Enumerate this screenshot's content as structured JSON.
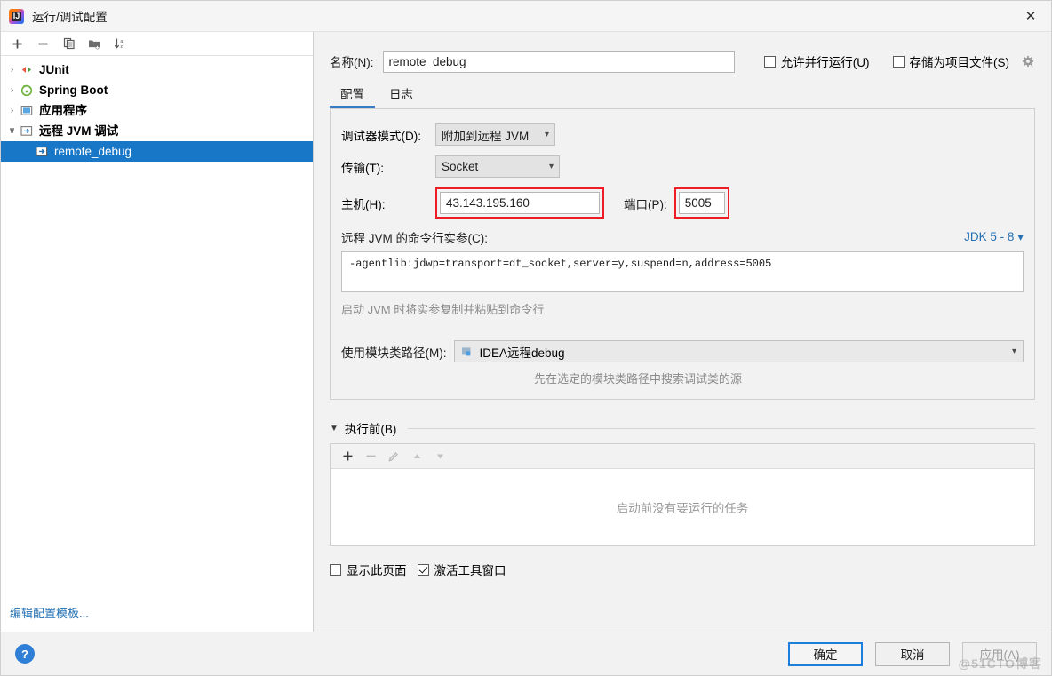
{
  "window": {
    "title": "运行/调试配置",
    "app_icon": "intellij-idea-icon",
    "close_label": "✕"
  },
  "sidebar": {
    "toolbar": [
      {
        "name": "add-configuration-button",
        "glyph": "+"
      },
      {
        "name": "remove-configuration-button",
        "glyph": "–"
      },
      {
        "name": "copy-configuration-button",
        "glyph": "copy-icon"
      },
      {
        "name": "new-folder-button",
        "glyph": "folder-add-icon"
      },
      {
        "name": "sort-configurations-button",
        "glyph": "sort-az-icon"
      }
    ],
    "tree": [
      {
        "label": "JUnit",
        "icon": "junit-icon",
        "expanded": false,
        "selected": false,
        "child": false
      },
      {
        "label": "Spring Boot",
        "icon": "spring-boot-icon",
        "expanded": false,
        "selected": false,
        "child": false
      },
      {
        "label": "应用程序",
        "icon": "application-icon",
        "expanded": false,
        "selected": false,
        "child": false
      },
      {
        "label": "远程 JVM 调试",
        "icon": "remote-jvm-debug-icon",
        "expanded": true,
        "selected": false,
        "child": false
      },
      {
        "label": "remote_debug",
        "icon": "remote-jvm-debug-icon",
        "expanded": null,
        "selected": true,
        "child": true
      }
    ],
    "edit_templates_link": "编辑配置模板..."
  },
  "form": {
    "name_label": "名称(N):",
    "name_value": "remote_debug",
    "allow_parallel_label": "允许并行运行(U)",
    "allow_parallel_checked": false,
    "store_as_project_file_label": "存储为项目文件(S)",
    "store_as_project_file_checked": false,
    "gear_icon": "gear-icon"
  },
  "tabs": [
    {
      "label": "配置",
      "active": true
    },
    {
      "label": "日志",
      "active": false
    }
  ],
  "config": {
    "debugger_mode_label": "调试器模式(D):",
    "debugger_mode_value": "附加到远程 JVM",
    "transport_label": "传输(T):",
    "transport_value": "Socket",
    "host_label": "主机(H):",
    "host_value": "43.143.195.160",
    "port_label": "端口(P):",
    "port_value": "5005",
    "args_label": "远程 JVM 的命令行实参(C):",
    "jdk_selector": "JDK 5 - 8",
    "args_value": "-agentlib:jdwp=transport=dt_socket,server=y,suspend=n,address=5005",
    "args_hint": "启动 JVM 时将实参复制并粘贴到命令行",
    "module_label": "使用模块类路径(M):",
    "module_value": "IDEA远程debug",
    "module_hint": "先在选定的模块类路径中搜索调试类的源",
    "highlight_color": "#ee1c25"
  },
  "before_launch": {
    "title": "执行前(B)",
    "toolbar": [
      {
        "name": "add-task-button",
        "glyph": "+",
        "enabled": true
      },
      {
        "name": "remove-task-button",
        "glyph": "–",
        "enabled": false
      },
      {
        "name": "edit-task-button",
        "glyph": "pencil-icon",
        "enabled": false
      },
      {
        "name": "move-up-button",
        "glyph": "▲",
        "enabled": false
      },
      {
        "name": "move-down-button",
        "glyph": "▼",
        "enabled": false
      }
    ],
    "empty_message": "启动前没有要运行的任务",
    "show_page_label": "显示此页面",
    "show_page_checked": false,
    "activate_tool_window_label": "激活工具窗口",
    "activate_tool_window_checked": true
  },
  "footer": {
    "help_glyph": "?",
    "ok_label": "确定",
    "cancel_label": "取消",
    "apply_label": "应用(A)",
    "apply_enabled": false,
    "watermark": "@51CTO博客"
  }
}
